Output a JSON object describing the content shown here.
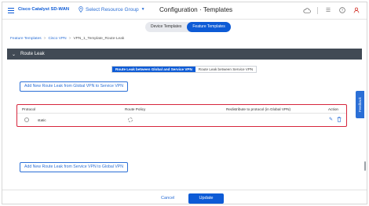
{
  "header": {
    "brand": "Cisco Catalyst SD-WAN",
    "resource_group": "Select Resource Group",
    "page_title": "Configuration · Templates"
  },
  "template_tabs": [
    {
      "label": "Device Templates",
      "active": false
    },
    {
      "label": "Feature Templates",
      "active": true
    }
  ],
  "breadcrumb": {
    "item1": "Feature Templates",
    "sep1": ">",
    "item2": "Cisco VPN",
    "sep2": ">",
    "current": "VPN_1_Template_Route-Leak"
  },
  "section": {
    "title": "Route Leak"
  },
  "route_leak_tabs": [
    {
      "label": "Route Leak between Global and Service VPN",
      "active": true
    },
    {
      "label": "Route Leak between Service VPN",
      "active": false
    }
  ],
  "buttons": {
    "add_global_to_service": "Add New Route Leak from Global VPN to Service VPN",
    "add_service_to_global": "Add New Route Leak from Service VPN to Global VPN"
  },
  "table": {
    "columns": {
      "protocol": "Protocol",
      "route_policy": "Route Policy",
      "redistribute": "Redistribute to protocol (in Global VPN)",
      "action": "Action"
    },
    "rows": [
      {
        "protocol": "static"
      }
    ]
  },
  "feedback_label": "Feedback",
  "footer": {
    "cancel": "Cancel",
    "update": "Update"
  },
  "colors": {
    "brand_blue": "#0d5bd6",
    "section_bg": "#414a55",
    "highlight_red": "#d6253c"
  }
}
